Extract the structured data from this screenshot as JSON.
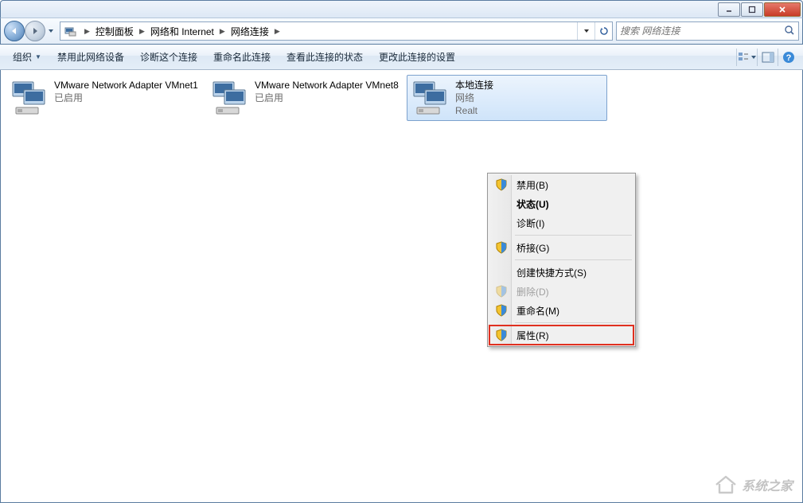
{
  "breadcrumb": {
    "items": [
      "控制面板",
      "网络和 Internet",
      "网络连接"
    ]
  },
  "search": {
    "placeholder": "搜索 网络连接"
  },
  "cmdbar": {
    "organize": "组织",
    "disable": "禁用此网络设备",
    "diagnose": "诊断这个连接",
    "rename": "重命名此连接",
    "viewStatus": "查看此连接的状态",
    "changeSettings": "更改此连接的设置"
  },
  "connections": [
    {
      "name": "VMware Network Adapter VMnet1",
      "status": "已启用",
      "detail": ""
    },
    {
      "name": "VMware Network Adapter VMnet8",
      "status": "已启用",
      "detail": ""
    },
    {
      "name": "本地连接",
      "status": "网络",
      "detail": "Realt"
    }
  ],
  "contextMenu": {
    "disable": "禁用(B)",
    "status": "状态(U)",
    "diagnose": "诊断(I)",
    "bridge": "桥接(G)",
    "shortcut": "创建快捷方式(S)",
    "delete": "删除(D)",
    "rename": "重命名(M)",
    "properties": "属性(R)"
  },
  "watermark": "系统之家"
}
